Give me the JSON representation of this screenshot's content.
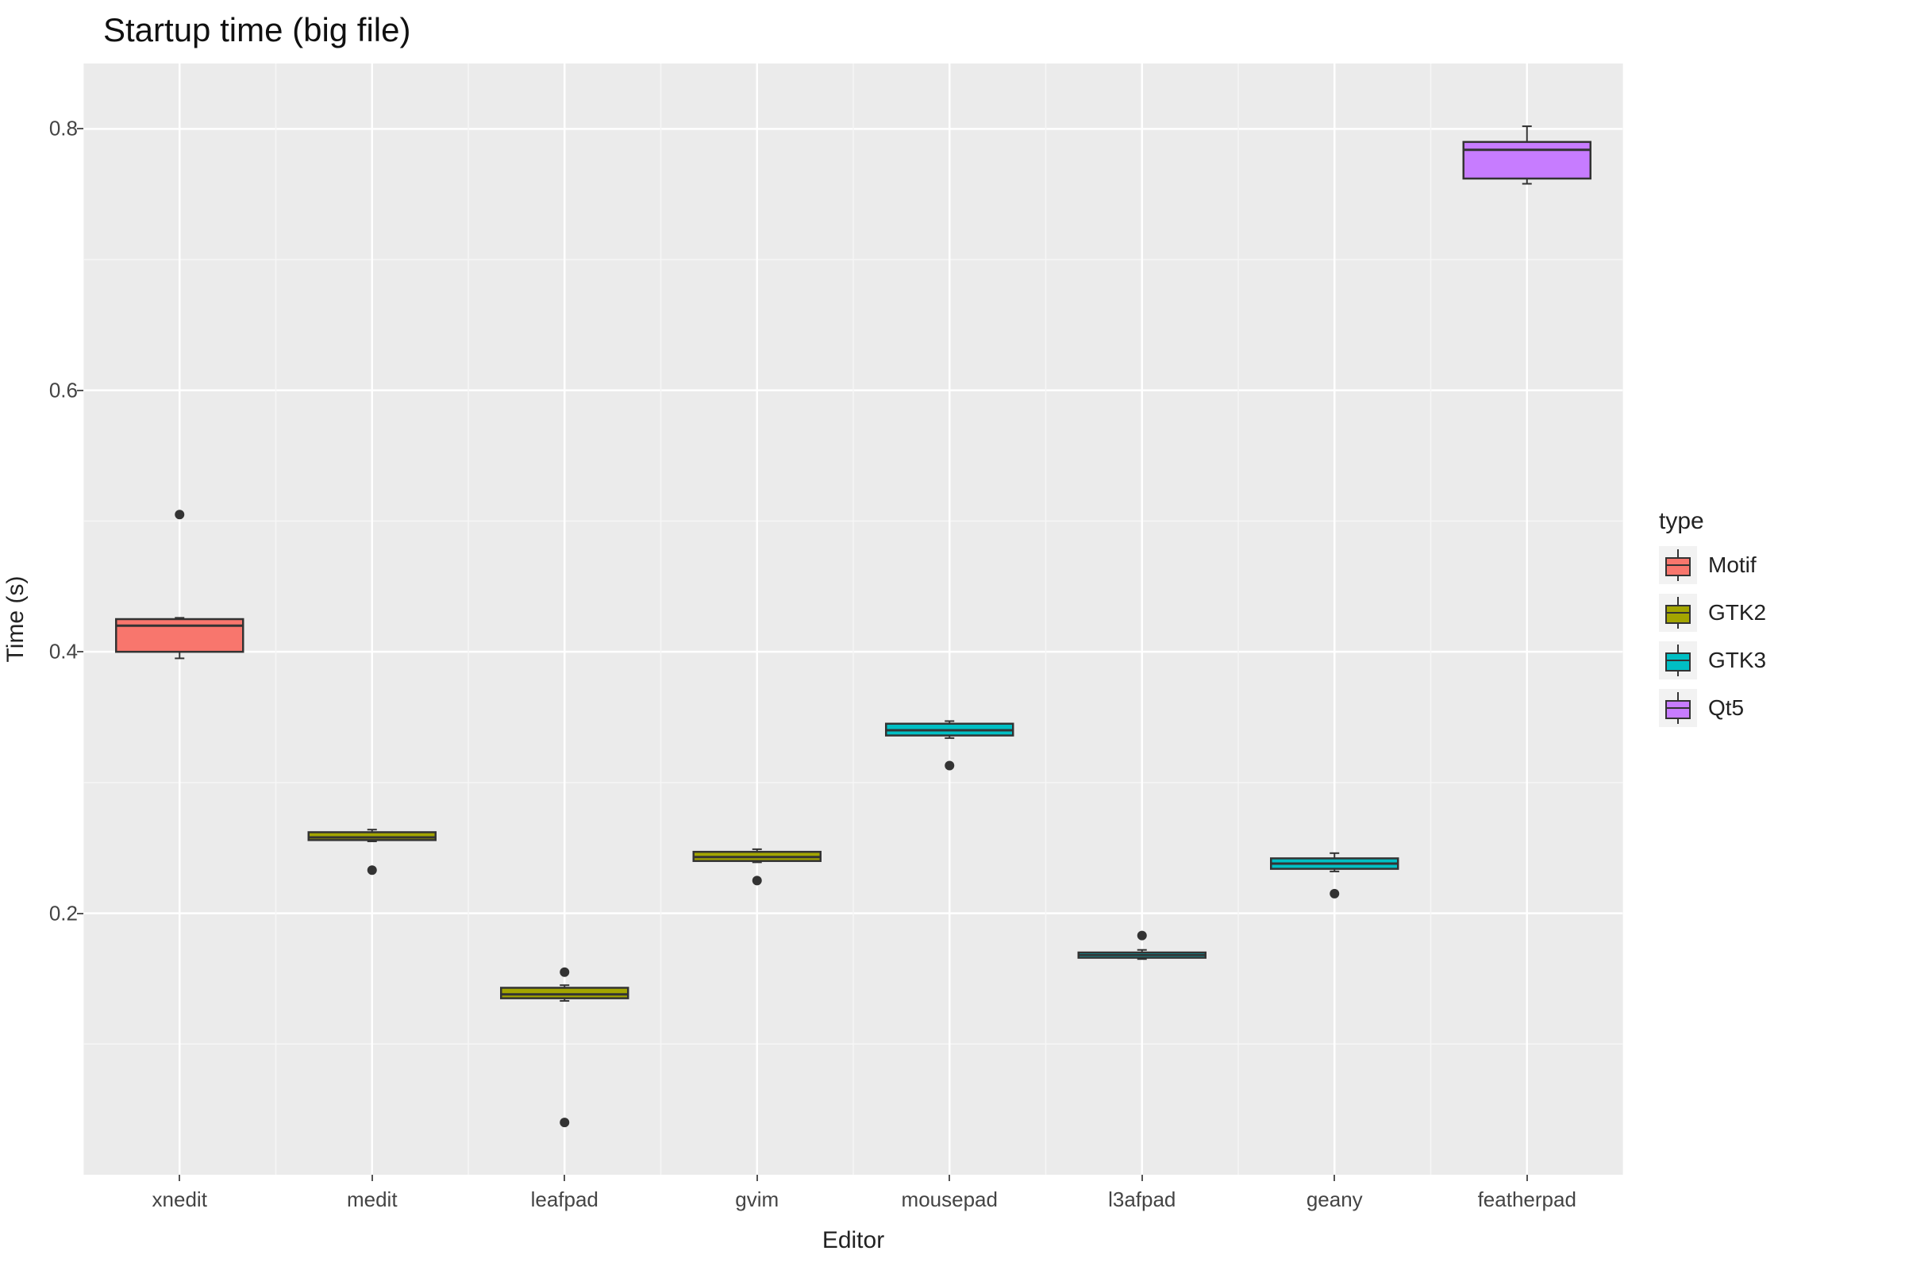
{
  "chart_data": {
    "type": "boxplot",
    "title": "Startup time (big file)",
    "xlabel": "Editor",
    "ylabel": "Time (s)",
    "ylim": [
      0.0,
      0.85
    ],
    "y_ticks": [
      0.2,
      0.4,
      0.6,
      0.8
    ],
    "categories": [
      "xnedit",
      "medit",
      "leafpad",
      "gvim",
      "mousepad",
      "l3afpad",
      "geany",
      "featherpad"
    ],
    "legend_title": "type",
    "legend": [
      {
        "name": "Motif",
        "color": "#F8766D"
      },
      {
        "name": "GTK2",
        "color": "#A3A500"
      },
      {
        "name": "GTK3",
        "color": "#00BFC4"
      },
      {
        "name": "Qt5",
        "color": "#C77CFF"
      }
    ],
    "series": [
      {
        "editor": "xnedit",
        "type": "Motif",
        "color": "#F8766D",
        "lower_whisker": 0.395,
        "q1": 0.4,
        "median": 0.42,
        "q3": 0.425,
        "upper_whisker": 0.426,
        "outliers": [
          0.505
        ]
      },
      {
        "editor": "medit",
        "type": "GTK2",
        "color": "#A3A500",
        "lower_whisker": 0.255,
        "q1": 0.256,
        "median": 0.258,
        "q3": 0.262,
        "upper_whisker": 0.264,
        "outliers": [
          0.233
        ]
      },
      {
        "editor": "leafpad",
        "type": "GTK2",
        "color": "#A3A500",
        "lower_whisker": 0.133,
        "q1": 0.135,
        "median": 0.138,
        "q3": 0.143,
        "upper_whisker": 0.145,
        "outliers": [
          0.155,
          0.04
        ]
      },
      {
        "editor": "gvim",
        "type": "GTK2",
        "color": "#A3A500",
        "lower_whisker": 0.239,
        "q1": 0.24,
        "median": 0.243,
        "q3": 0.247,
        "upper_whisker": 0.249,
        "outliers": [
          0.225
        ]
      },
      {
        "editor": "mousepad",
        "type": "GTK3",
        "color": "#00BFC4",
        "lower_whisker": 0.334,
        "q1": 0.336,
        "median": 0.34,
        "q3": 0.345,
        "upper_whisker": 0.347,
        "outliers": [
          0.313
        ]
      },
      {
        "editor": "l3afpad",
        "type": "GTK3",
        "color": "#00BFC4",
        "lower_whisker": 0.165,
        "q1": 0.166,
        "median": 0.168,
        "q3": 0.17,
        "upper_whisker": 0.172,
        "outliers": [
          0.183
        ]
      },
      {
        "editor": "geany",
        "type": "GTK3",
        "color": "#00BFC4",
        "lower_whisker": 0.232,
        "q1": 0.234,
        "median": 0.238,
        "q3": 0.242,
        "upper_whisker": 0.246,
        "outliers": [
          0.215
        ]
      },
      {
        "editor": "featherpad",
        "type": "Qt5",
        "color": "#C77CFF",
        "lower_whisker": 0.758,
        "q1": 0.762,
        "median": 0.784,
        "q3": 0.79,
        "upper_whisker": 0.802,
        "outliers": []
      }
    ]
  }
}
